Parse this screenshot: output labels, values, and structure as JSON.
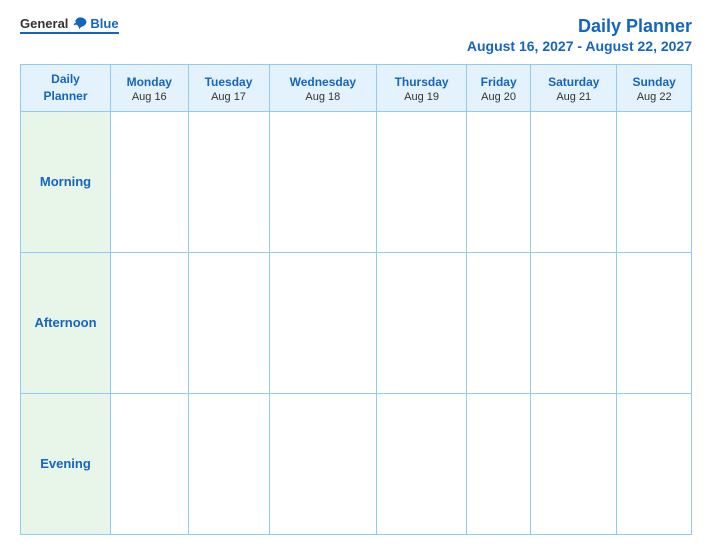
{
  "logo": {
    "general": "General",
    "blue": "Blue"
  },
  "header": {
    "title": "Daily Planner",
    "date_range": "August 16, 2027 - August 22, 2027"
  },
  "columns": [
    {
      "label": "Daily\nPlanner",
      "day": "",
      "is_main": true
    },
    {
      "label": "Monday",
      "day": "Aug 16"
    },
    {
      "label": "Tuesday",
      "day": "Aug 17"
    },
    {
      "label": "Wednesday",
      "day": "Aug 18"
    },
    {
      "label": "Thursday",
      "day": "Aug 19"
    },
    {
      "label": "Friday",
      "day": "Aug 20"
    },
    {
      "label": "Saturday",
      "day": "Aug 21"
    },
    {
      "label": "Sunday",
      "day": "Aug 22"
    }
  ],
  "rows": [
    {
      "label": "Morning"
    },
    {
      "label": "Afternoon"
    },
    {
      "label": "Evening"
    }
  ]
}
